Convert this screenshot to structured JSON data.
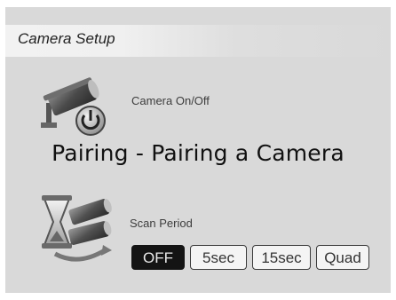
{
  "header": {
    "title": "Camera Setup"
  },
  "items": {
    "camera_onoff": {
      "label": "Camera On/Off",
      "icon": "camera-power-icon"
    },
    "scan_period": {
      "label": "Scan Period",
      "icon": "camera-scan-icon"
    }
  },
  "overlay": {
    "title": "Pairing - Pairing a Camera"
  },
  "scan_options": [
    "OFF",
    "5sec",
    "15sec",
    "Quad"
  ],
  "selected_option": "OFF"
}
